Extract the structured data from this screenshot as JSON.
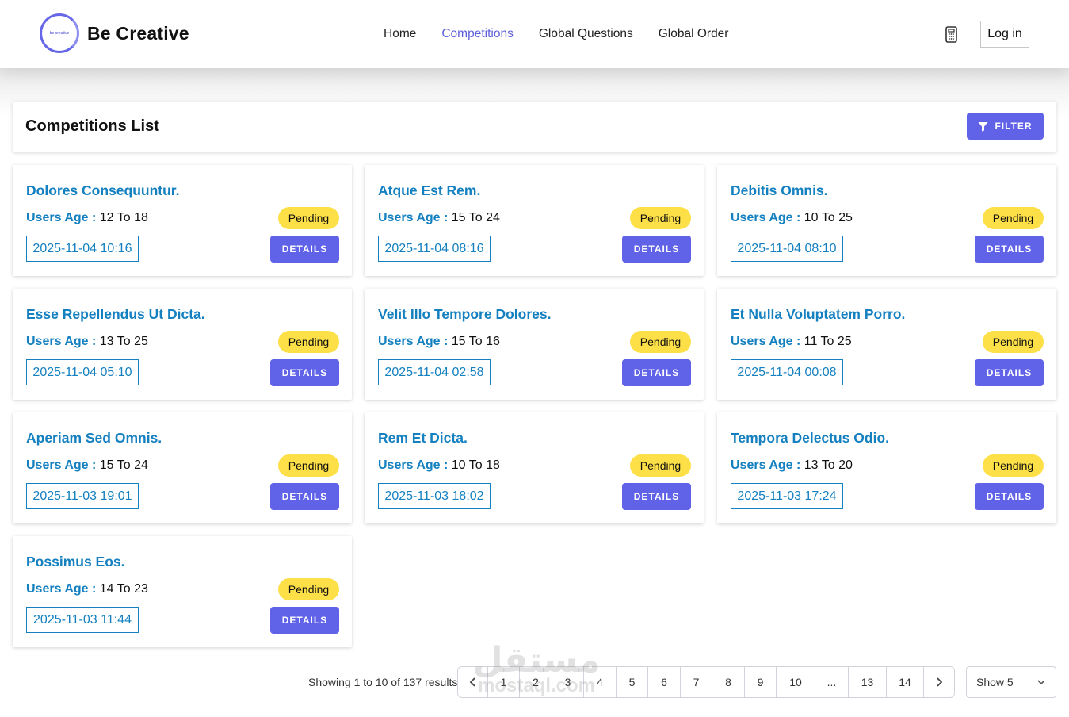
{
  "header": {
    "logo_text": "be creative",
    "brand": "Be Creative",
    "nav": [
      {
        "label": "Home",
        "active": false
      },
      {
        "label": "Competitions",
        "active": true
      },
      {
        "label": "Global Questions",
        "active": false
      },
      {
        "label": "Global Order",
        "active": false
      }
    ],
    "calculator_icon": "calculator-icon",
    "login_label": "Log in"
  },
  "list": {
    "title": "Competitions List",
    "filter_label": "FILTER",
    "filter_icon": "funnel-icon"
  },
  "cards": [
    {
      "title": "Dolores Consequuntur.",
      "age_label": "Users Age :",
      "age": "12 To 18",
      "status": "Pending",
      "date": "2025-11-04 10:16",
      "details": "DETAILS"
    },
    {
      "title": "Atque Est Rem.",
      "age_label": "Users Age :",
      "age": "15 To 24",
      "status": "Pending",
      "date": "2025-11-04 08:16",
      "details": "DETAILS"
    },
    {
      "title": "Debitis Omnis.",
      "age_label": "Users Age :",
      "age": "10 To 25",
      "status": "Pending",
      "date": "2025-11-04 08:10",
      "details": "DETAILS"
    },
    {
      "title": "Esse Repellendus Ut Dicta.",
      "age_label": "Users Age :",
      "age": "13 To 25",
      "status": "Pending",
      "date": "2025-11-04 05:10",
      "details": "DETAILS"
    },
    {
      "title": "Velit Illo Tempore Dolores.",
      "age_label": "Users Age :",
      "age": "15 To 16",
      "status": "Pending",
      "date": "2025-11-04 02:58",
      "details": "DETAILS"
    },
    {
      "title": "Et Nulla Voluptatem Porro.",
      "age_label": "Users Age :",
      "age": "11 To 25",
      "status": "Pending",
      "date": "2025-11-04 00:08",
      "details": "DETAILS"
    },
    {
      "title": "Aperiam Sed Omnis.",
      "age_label": "Users Age :",
      "age": "15 To 24",
      "status": "Pending",
      "date": "2025-11-03 19:01",
      "details": "DETAILS"
    },
    {
      "title": "Rem Et Dicta.",
      "age_label": "Users Age :",
      "age": "10 To 18",
      "status": "Pending",
      "date": "2025-11-03 18:02",
      "details": "DETAILS"
    },
    {
      "title": "Tempora Delectus Odio.",
      "age_label": "Users Age :",
      "age": "13 To 20",
      "status": "Pending",
      "date": "2025-11-03 17:24",
      "details": "DETAILS"
    },
    {
      "title": "Possimus Eos.",
      "age_label": "Users Age :",
      "age": "14 To 23",
      "status": "Pending",
      "date": "2025-11-03 11:44",
      "details": "DETAILS"
    }
  ],
  "pagination": {
    "showing": "Showing 1 to 10 of 137 results",
    "pages": [
      "1",
      "2",
      "3",
      "4",
      "5",
      "6",
      "7",
      "8",
      "9",
      "10",
      "...",
      "13",
      "14"
    ],
    "prev_icon": "chevron-left-icon",
    "next_icon": "chevron-right-icon",
    "per_page": "Show 5"
  },
  "watermark": {
    "arabic": "مستقل",
    "latin": "mostaql.com"
  },
  "colors": {
    "accent": "#6062e8",
    "link": "#1480c0",
    "badge": "#fde047"
  }
}
